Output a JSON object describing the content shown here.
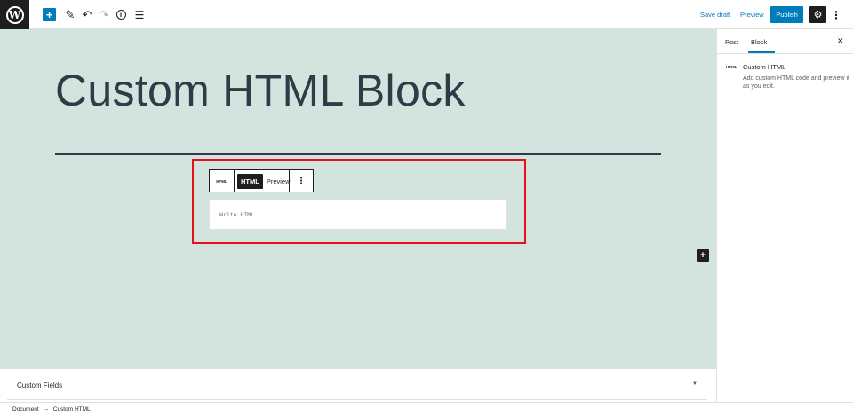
{
  "topbar": {
    "logo_glyph": "W",
    "add_glyph": "+",
    "edit_glyph": "✎",
    "undo_glyph": "↶",
    "redo_glyph": "↷",
    "info_glyph": "i",
    "outline_glyph": "☰",
    "save_draft": "Save draft",
    "preview": "Preview",
    "publish": "Publish",
    "settings_glyph": "⚙",
    "more_glyph": "⋮"
  },
  "editor": {
    "title": "Custom HTML Block",
    "block_toolbar": {
      "type_label": "HTML",
      "html_tab": "HTML",
      "preview_tab": "Preview",
      "more_glyph": "⋮"
    },
    "html_placeholder": "Write HTML…",
    "inserter_glyph": "+"
  },
  "metabox": {
    "title": "Custom Fields",
    "toggle_glyph": "▼"
  },
  "footer": {
    "breadcrumb": [
      "Document",
      "→",
      "Custom HTML"
    ]
  },
  "sidebar": {
    "tabs": [
      {
        "label": "Post"
      },
      {
        "label": "Block"
      }
    ],
    "active_tab": "Block",
    "close_glyph": "✕",
    "block_card": {
      "icon_label": "HTML",
      "title": "Custom HTML",
      "description": "Add custom HTML code and preview it as you edit."
    }
  },
  "colors": {
    "accent": "#007cba",
    "canvas_bg": "#d3e4de",
    "title_text": "#2f3b46",
    "highlight_outline": "#e3121b",
    "dark": "#1e1e1e"
  }
}
